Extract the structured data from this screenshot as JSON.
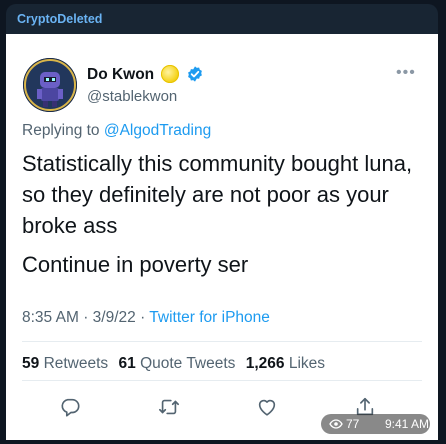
{
  "channel": {
    "name": "CryptoDeleted"
  },
  "tweet": {
    "author_name": "Do Kwon",
    "handle": "@stablekwon",
    "replying_prefix": "Replying to",
    "replying_to": "@AlgodTrading",
    "text_paragraphs": [
      "Statistically this community bought luna, so they definitely are not poor as your broke ass",
      "Continue in poverty ser"
    ],
    "time": "8:35 AM",
    "date": "3/9/22",
    "separator": "·",
    "source": "Twitter for iPhone",
    "stats": {
      "retweets_count": "59",
      "retweets_label": "Retweets",
      "quotes_count": "61",
      "quotes_label": "Quote Tweets",
      "likes_count": "1,266",
      "likes_label": "Likes"
    },
    "icons": {
      "coin": "coin-emoji-icon",
      "verified": "verified-badge-icon",
      "more": "more-options-icon",
      "reply": "reply-icon",
      "retweet": "retweet-icon",
      "like": "heart-icon",
      "share": "share-icon"
    }
  },
  "message_meta": {
    "views": "77",
    "time": "9:41 AM",
    "views_icon": "eye-icon"
  },
  "colors": {
    "telegram_bg": "#0e1621",
    "bubble_bg": "#182533",
    "channel_name": "#6ab3f3",
    "twitter_blue": "#1d9bf0",
    "secondary_text": "#536471",
    "primary_text": "#0f1419"
  }
}
